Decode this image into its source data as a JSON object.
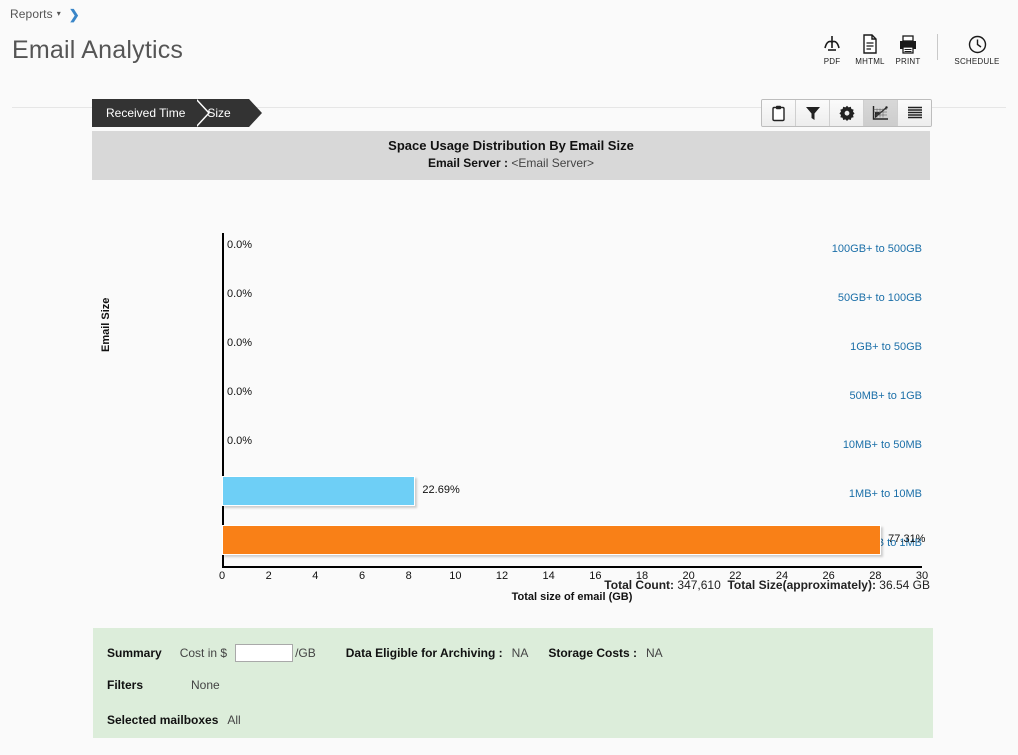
{
  "breadcrumb": {
    "root_label": "Reports",
    "caret": "▾",
    "arrow": "❯"
  },
  "header": {
    "title": "Email Analytics",
    "tools": [
      {
        "name": "pdf",
        "label": "PDF"
      },
      {
        "name": "mhtml",
        "label": "MHTML"
      },
      {
        "name": "print",
        "label": "PRINT"
      },
      {
        "name": "schedule",
        "label": "SCHEDULE"
      }
    ]
  },
  "tabs": [
    {
      "label": "Received Time",
      "active": false
    },
    {
      "label": "Size",
      "active": true
    }
  ],
  "panel_toolbar": [
    {
      "name": "clipboard-icon",
      "active": false
    },
    {
      "name": "filter-icon",
      "active": false
    },
    {
      "name": "settings-gear-icon",
      "active": false
    },
    {
      "name": "chart-view-icon",
      "active": true
    },
    {
      "name": "list-view-icon",
      "active": false
    }
  ],
  "chart_header": {
    "title": "Space Usage Distribution By Email Size",
    "server_label": "Email Server :",
    "server_value": "<Email Server>"
  },
  "chart_data": {
    "type": "bar",
    "orientation": "horizontal",
    "title": "Space Usage Distribution By Email Size",
    "subtitle": "Email Server : <Email Server>",
    "xlabel": "Total size of email (GB)",
    "ylabel": "Email Size",
    "xlim": [
      0,
      30
    ],
    "xticks": [
      0,
      2,
      4,
      6,
      8,
      10,
      12,
      14,
      16,
      18,
      20,
      22,
      24,
      26,
      28,
      30
    ],
    "grid": false,
    "legend": "none",
    "categories": [
      "100GB+ to 500GB",
      "50GB+ to 100GB",
      "1GB+ to 50GB",
      "50MB+ to 1GB",
      "10MB+ to 50MB",
      "1MB+ to 10MB",
      "0KB to 1MB"
    ],
    "values": [
      0,
      0,
      0,
      0,
      0,
      8.29,
      28.25
    ],
    "data_labels": [
      "0.0%",
      "0.0%",
      "0.0%",
      "0.0%",
      "0.0%",
      "22.69%",
      "77.31%"
    ],
    "percentages": [
      0.0,
      0.0,
      0.0,
      0.0,
      0.0,
      22.69,
      77.31
    ],
    "colors": [
      "#6ecff6",
      "#6ecff6",
      "#6ecff6",
      "#6ecff6",
      "#6ecff6",
      "#6ecff6",
      "#f98017"
    ]
  },
  "totals": {
    "count_label": "Total Count:",
    "count_value": "347,610",
    "size_label": "Total Size(approximately):",
    "size_value": "36.54 GB"
  },
  "summary": {
    "summary_label": "Summary",
    "cost_label": "Cost in $",
    "cost_value": "",
    "cost_unit": "/GB",
    "archiving_label": "Data Eligible for Archiving :",
    "archiving_value": "NA",
    "storage_label": "Storage Costs :",
    "storage_value": "NA",
    "filters_label": "Filters",
    "filters_value": "None",
    "mailboxes_label": "Selected mailboxes",
    "mailboxes_value": "All"
  },
  "colors": {
    "accent_blue": "#1b6fa8",
    "bar_blue": "#6ecff6",
    "bar_orange": "#f98017",
    "summary_green": "#dcedda",
    "tab_dark": "#333333"
  }
}
